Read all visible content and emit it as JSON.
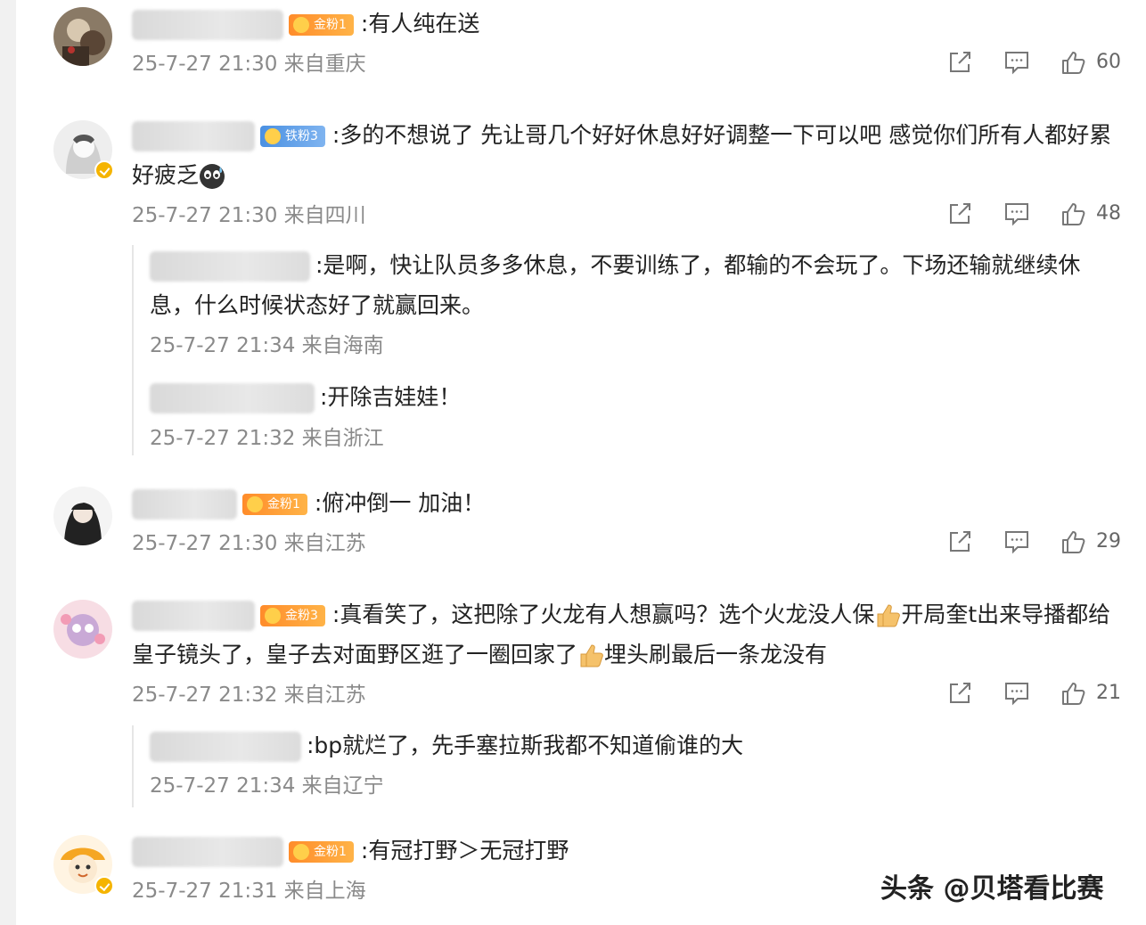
{
  "comments": [
    {
      "fan_badge": "金粉1",
      "text": ":有人纯在送",
      "time": "25-7-27 21:30",
      "location": "来自重庆",
      "likes": "60"
    },
    {
      "fan_badge": "铁粉3",
      "text": ":多的不想说了 先让哥几个好好休息好好调整一下可以吧 感觉你们所有人都好累好疲乏",
      "time": "25-7-27 21:30",
      "location": "来自四川",
      "likes": "48",
      "replies": [
        {
          "text": ":是啊，快让队员多多休息，不要训练了，都输的不会玩了。下场还输就继续休息，什么时候状态好了就赢回来。",
          "time": "25-7-27 21:34",
          "location": "来自海南"
        },
        {
          "text": ":开除吉娃娃！",
          "time": "25-7-27 21:32",
          "location": "来自浙江"
        }
      ]
    },
    {
      "fan_badge": "金粉1",
      "text": ":俯冲倒一 加油！",
      "time": "25-7-27 21:30",
      "location": "来自江苏",
      "likes": "29"
    },
    {
      "fan_badge": "金粉3",
      "text_part1": ":真看笑了，这把除了火龙有人想赢吗？选个火龙没人保",
      "text_part2": "开局奎t出来导播都给皇子镜头了，皇子去对面野区逛了一圈回家了",
      "text_part3": "埋头刷最后一条龙没有",
      "time": "25-7-27 21:32",
      "location": "来自江苏",
      "likes": "21",
      "replies": [
        {
          "text": ":bp就烂了，先手塞拉斯我都不知道偷谁的大",
          "time": "25-7-27 21:34",
          "location": "来自辽宁"
        }
      ]
    },
    {
      "fan_badge": "金粉1",
      "text": ":有冠打野＞无冠打野",
      "time": "25-7-27 21:31",
      "location": "来自上海"
    }
  ],
  "watermark": "头条 @贝塔看比赛",
  "icons": {
    "share": "share-icon",
    "comment": "comment-icon",
    "like": "thumbs-up-icon",
    "emoji_sweat": "sweat-face-emoji-icon",
    "emoji_thumb": "thumbs-up-emoji-icon",
    "verified": "verified-badge-icon"
  },
  "colors": {
    "gold_badge": "#ff8c2a",
    "iron_badge": "#4a90e2",
    "meta_text": "#8a8a8a",
    "verified": "#f5b400"
  }
}
